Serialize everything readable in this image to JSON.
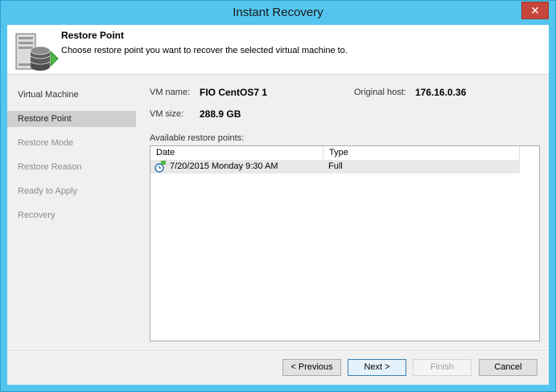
{
  "window": {
    "title": "Instant Recovery",
    "close_label": "✕"
  },
  "header": {
    "title": "Restore Point",
    "description": "Choose restore point you want to recover the selected virtual machine to."
  },
  "steps": [
    {
      "label": "Virtual Machine"
    },
    {
      "label": "Restore Point"
    },
    {
      "label": "Restore Mode"
    },
    {
      "label": "Restore Reason"
    },
    {
      "label": "Ready to Apply"
    },
    {
      "label": "Recovery"
    }
  ],
  "vm_info": {
    "name_label": "VM name:",
    "name": "FIO CentOS7 1",
    "size_label": "VM size:",
    "size": "288.9 GB",
    "host_label": "Original host:",
    "host": "176.16.0.36"
  },
  "restore_points": {
    "label": "Available restore points:",
    "columns": [
      "Date",
      "Type"
    ],
    "rows": [
      {
        "date": "7/20/2015 Monday 9:30 AM",
        "type": "Full",
        "icon": "restore-point-clock-icon"
      }
    ]
  },
  "buttons": {
    "previous": "< Previous",
    "next": "Next >",
    "finish": "Finish",
    "cancel": "Cancel"
  },
  "colors": {
    "title_bar": "#54c5ee",
    "close_button": "#c7463c",
    "selected_step": "#cfcfcf",
    "selected_row": "#e8e8e8"
  }
}
